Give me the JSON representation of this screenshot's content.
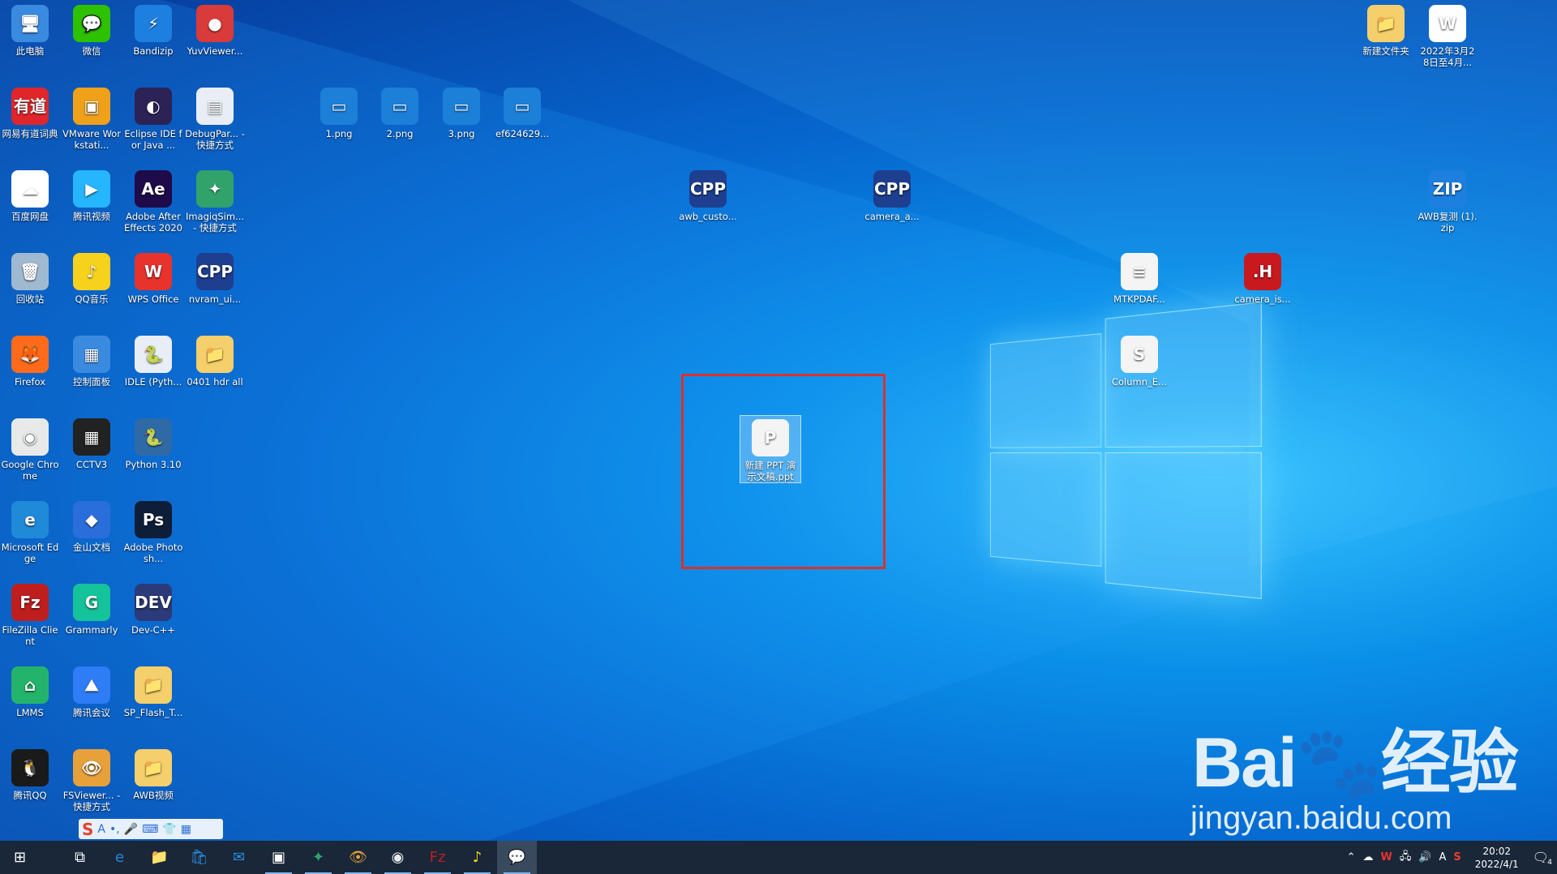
{
  "desktop_icons_left": [
    {
      "label": "此电脑",
      "icon": "computer-icon",
      "color": "#3a8be0",
      "glyph": "🖥"
    },
    {
      "label": "微信",
      "icon": "wechat-icon",
      "color": "#2dc100",
      "glyph": "💬"
    },
    {
      "label": "Bandizip",
      "icon": "bandizip-icon",
      "color": "#1d7fe0",
      "glyph": "⚡"
    },
    {
      "label": "YuvViewer...",
      "icon": "yuvviewer-icon",
      "color": "#d93a3a",
      "glyph": "●"
    },
    {
      "label": "网易有道词典",
      "icon": "youdao-icon",
      "color": "#e0262b",
      "glyph": "有道"
    },
    {
      "label": "VMware Workstati...",
      "icon": "vmware-icon",
      "color": "#f0a11a",
      "glyph": "▣"
    },
    {
      "label": "Eclipse IDE for Java ...",
      "icon": "eclipse-icon",
      "color": "#2c2255",
      "glyph": "◐"
    },
    {
      "label": "DebugPar... - 快捷方式",
      "icon": "debugparser-icon",
      "color": "#e9eef6",
      "glyph": "▤"
    },
    {
      "label": "百度网盘",
      "icon": "baidu-netdisk-icon",
      "color": "#ffffff",
      "glyph": "☁"
    },
    {
      "label": "腾讯视频",
      "icon": "tencent-video-icon",
      "color": "#26b5ff",
      "glyph": "▶"
    },
    {
      "label": "Adobe After Effects 2020",
      "icon": "after-effects-icon",
      "color": "#1f0a4a",
      "glyph": "Ae"
    },
    {
      "label": "ImagiqSim... - 快捷方式",
      "icon": "imagiqsim-icon",
      "color": "#31a36a",
      "glyph": "✦"
    },
    {
      "label": "回收站",
      "icon": "recycle-bin-icon",
      "color": "#9fb9d0",
      "glyph": "🗑"
    },
    {
      "label": "QQ音乐",
      "icon": "qq-music-icon",
      "color": "#f7d21c",
      "glyph": "♪"
    },
    {
      "label": "WPS Office",
      "icon": "wps-icon",
      "color": "#e8332c",
      "glyph": "W"
    },
    {
      "label": "nvram_ui...",
      "icon": "cpp-file-icon",
      "color": "#1e3e8f",
      "glyph": "CPP"
    },
    {
      "label": "Firefox",
      "icon": "firefox-icon",
      "color": "#ff6b1a",
      "glyph": "🦊"
    },
    {
      "label": "控制面板",
      "icon": "control-panel-icon",
      "color": "#3a8be0",
      "glyph": "▦"
    },
    {
      "label": "IDLE (Pyth...",
      "icon": "python-idle-icon",
      "color": "#e9eef6",
      "glyph": "🐍"
    },
    {
      "label": "0401 hdr all",
      "icon": "folder-icon",
      "color": "#f5cf6b",
      "glyph": "📁"
    },
    {
      "label": "Google Chrome",
      "icon": "chrome-icon",
      "color": "#e8eaea",
      "glyph": "◉"
    },
    {
      "label": "CCTV3",
      "icon": "cctv3-icon",
      "color": "#222222",
      "glyph": "▦"
    },
    {
      "label": "Python 3.10",
      "icon": "python-icon",
      "color": "#2f6aa6",
      "glyph": "🐍"
    },
    {
      "label": "Microsoft Edge",
      "icon": "edge-icon",
      "color": "#1f8ad8",
      "glyph": "e"
    },
    {
      "label": "金山文档",
      "icon": "kdocs-icon",
      "color": "#2a6edb",
      "glyph": "◆"
    },
    {
      "label": "Adobe Photosh...",
      "icon": "photoshop-icon",
      "color": "#0e1e38",
      "glyph": "Ps"
    },
    {
      "label": "FileZilla Client",
      "icon": "filezilla-icon",
      "color": "#bf1e1e",
      "glyph": "Fz"
    },
    {
      "label": "Grammarly",
      "icon": "grammarly-icon",
      "color": "#15c39a",
      "glyph": "G"
    },
    {
      "label": "Dev-C++",
      "icon": "devcpp-icon",
      "color": "#2b3a78",
      "glyph": "DEV"
    },
    {
      "label": "LMMS",
      "icon": "lmms-icon",
      "color": "#24b36b",
      "glyph": "⌂"
    },
    {
      "label": "腾讯会议",
      "icon": "tencent-meeting-icon",
      "color": "#2e7cf6",
      "glyph": "⛰"
    },
    {
      "label": "SP_Flash_T...",
      "icon": "folder-icon",
      "color": "#f5cf6b",
      "glyph": "📁"
    },
    {
      "label": "腾讯QQ",
      "icon": "qq-icon",
      "color": "#1a1a1a",
      "glyph": "🐧"
    },
    {
      "label": "FSViewer... - 快捷方式",
      "icon": "fsviewer-icon",
      "color": "#e8a03a",
      "glyph": "👁"
    },
    {
      "label": "AWB视频",
      "icon": "folder-icon",
      "color": "#f5cf6b",
      "glyph": "📁"
    }
  ],
  "desktop_icons_other": [
    {
      "label": "1.png",
      "icon": "png-file-icon",
      "color": "#1c7fd8",
      "glyph": "▭"
    },
    {
      "label": "2.png",
      "icon": "png-file-icon",
      "color": "#1c7fd8",
      "glyph": "▭"
    },
    {
      "label": "3.png",
      "icon": "png-file-icon",
      "color": "#1c7fd8",
      "glyph": "▭"
    },
    {
      "label": "ef624629...",
      "icon": "png-file-icon",
      "color": "#1c7fd8",
      "glyph": "▭"
    },
    {
      "label": "awb_custo...",
      "icon": "cpp-file-icon",
      "color": "#1e3e8f",
      "glyph": "CPP"
    },
    {
      "label": "camera_a...",
      "icon": "cpp-file-icon",
      "color": "#1e3e8f",
      "glyph": "CPP"
    },
    {
      "label": "新建文件夹",
      "icon": "folder-icon",
      "color": "#f5cf6b",
      "glyph": "📁"
    },
    {
      "label": "2022年3月28日至4月...",
      "icon": "word-doc-icon",
      "color": "#ffffff",
      "glyph": "W"
    },
    {
      "label": "AWB复测 (1).zip",
      "icon": "zip-file-icon",
      "color": "#1d7fe0",
      "glyph": "ZIP"
    },
    {
      "label": "MTKPDAF...",
      "icon": "text-file-icon",
      "color": "#f4f4f4",
      "glyph": "≡"
    },
    {
      "label": "camera_is...",
      "icon": "header-file-icon",
      "color": "#c8191e",
      "glyph": ".H"
    },
    {
      "label": "Column_E...",
      "icon": "spreadsheet-icon",
      "color": "#f4f4f4",
      "glyph": "S"
    },
    {
      "label": "新建 PPT 演示文稿.ppt",
      "icon": "ppt-file-icon",
      "color": "#f4f4f4",
      "glyph": "P"
    }
  ],
  "ime_toolbar": {
    "logo": "S",
    "mode": "A",
    "punct": "•,",
    "mic": "🎤",
    "keyboard": "⌨",
    "skin": "👕",
    "apps": "▦"
  },
  "watermark": {
    "brand": "Bai🐾经验",
    "url": "jingyan.baidu.com"
  },
  "taskbar": {
    "start": "⊞",
    "taskview": "⧉",
    "apps": [
      {
        "name": "edge",
        "glyph": "e",
        "color": "#1f8ad8"
      },
      {
        "name": "file-explorer",
        "glyph": "📁",
        "color": "#f5cf6b"
      },
      {
        "name": "store",
        "glyph": "🛍",
        "color": "#2a8fe0"
      },
      {
        "name": "mail",
        "glyph": "✉",
        "color": "#2a8fe0"
      },
      {
        "name": "window",
        "glyph": "▣",
        "color": "#ffffff"
      },
      {
        "name": "imagiqsim",
        "glyph": "✦",
        "color": "#31a36a"
      },
      {
        "name": "fsviewer",
        "glyph": "👁",
        "color": "#e8a03a"
      },
      {
        "name": "chrome",
        "glyph": "◉",
        "color": "#e8eaea"
      },
      {
        "name": "filezilla",
        "glyph": "Fz",
        "color": "#bf1e1e"
      },
      {
        "name": "qq-music",
        "glyph": "♪",
        "color": "#f7d21c"
      },
      {
        "name": "wechat",
        "glyph": "💬",
        "color": "#2dc100"
      }
    ],
    "time": "20:02",
    "date": "2022/4/1",
    "notifications": "4"
  }
}
